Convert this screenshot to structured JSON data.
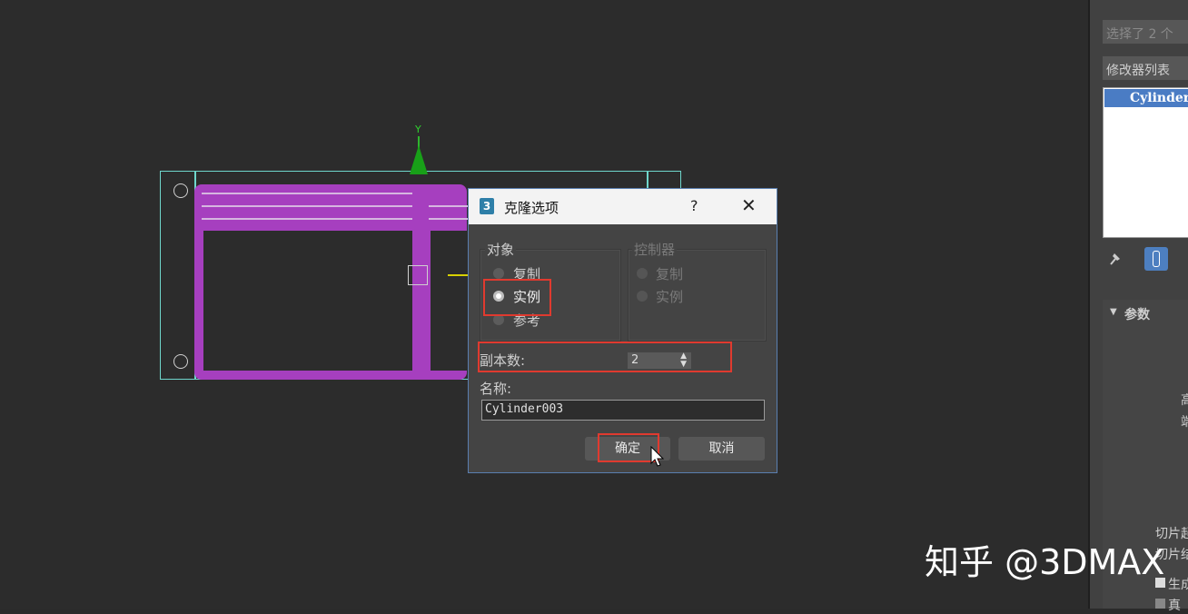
{
  "viewport": {
    "axis_label": "Y"
  },
  "dialog": {
    "icon_text": "3",
    "title": "克隆选项",
    "help": "?",
    "close": "✕",
    "object_group": {
      "label": "对象",
      "options": [
        "复制",
        "实例",
        "参考"
      ],
      "selected": "实例"
    },
    "controller_group": {
      "label": "控制器",
      "options": [
        "复制",
        "实例"
      ]
    },
    "copies_label": "副本数:",
    "copies_value": "2",
    "name_label": "名称:",
    "name_value": "Cylinder003",
    "ok_label": "确定",
    "cancel_label": "取消"
  },
  "panel": {
    "selection_text": "选择了 2 个",
    "modifier_list": "修改器列表",
    "stack_item": "Cylinder",
    "params_label": "参数",
    "partial_1": "高",
    "partial_2": "端",
    "partial_3": "切片起",
    "partial_4": "切片结",
    "partial_5": "生成",
    "partial_6": "真"
  },
  "watermark": "知乎 @3DMAX"
}
